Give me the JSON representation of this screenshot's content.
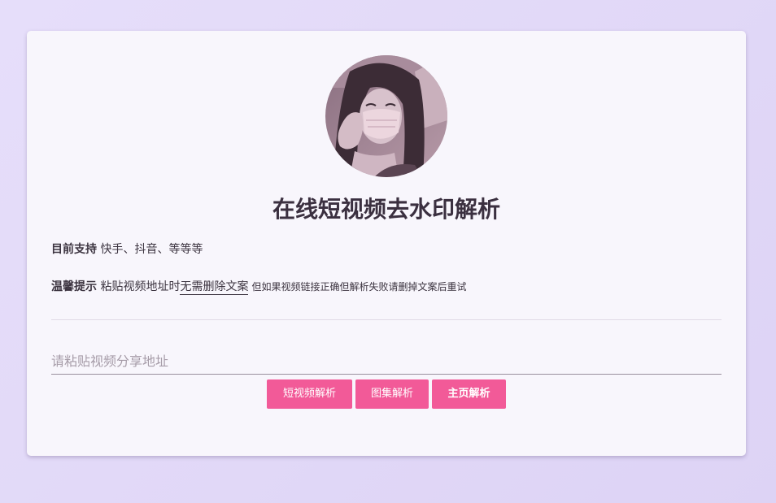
{
  "card": {
    "avatar_icon": "user-avatar-photo",
    "title": "在线短视频去水印解析",
    "support": {
      "label": "目前支持",
      "text": "快手、抖音、等等等"
    },
    "tip": {
      "label": "温馨提示",
      "text_before": "粘贴视频地址时",
      "underlined": "无需删除文案",
      "small_text": "但如果视频链接正确但解析失败请删掉文案后重试"
    },
    "input": {
      "placeholder": "请粘贴视频分享地址",
      "value": ""
    },
    "buttons": {
      "short_video": "短视频解析",
      "gallery": "图集解析",
      "homepage": "主页解析"
    }
  },
  "colors": {
    "accent": "#f25a98",
    "background": "#e6defa",
    "card": "#f8f6fc",
    "text": "#3b3040"
  }
}
